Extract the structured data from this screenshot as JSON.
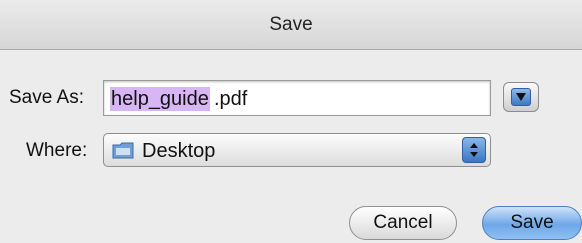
{
  "window": {
    "title": "Save"
  },
  "save_as": {
    "label": "Save As:",
    "name_selected": "help_guide",
    "extension": ".pdf"
  },
  "where": {
    "label": "Where:",
    "value": "Desktop"
  },
  "buttons": {
    "cancel": "Cancel",
    "save": "Save"
  },
  "icons": {
    "disclosure": "disclosure-triangle-icon",
    "folder": "desktop-folder-icon",
    "stepper": "popup-arrows-icon"
  },
  "colors": {
    "selection": "#d8b6f5",
    "accent": "#3a76c4"
  }
}
